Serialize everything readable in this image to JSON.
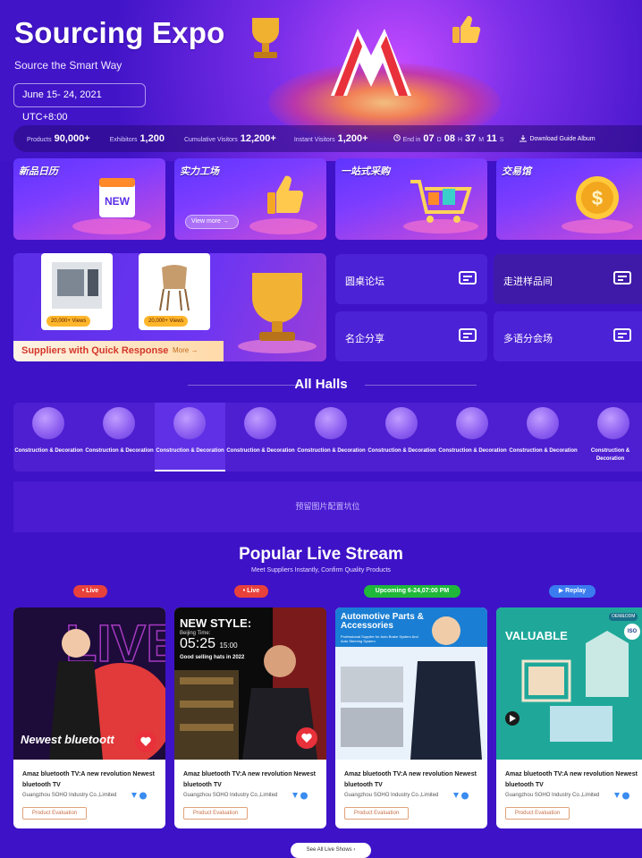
{
  "hero": {
    "title": "Sourcing Expo",
    "subtitle": "Source the Smart Way",
    "date": "June 15- 24, 2021 UTC+8:00"
  },
  "stats": {
    "products_label": "Products",
    "products_value": "90,000+",
    "exhibitors_label": "Exhibitors",
    "exhibitors_value": "1,200",
    "cumulative_label": "Cumulative Visitors",
    "cumulative_value": "12,200+",
    "instant_label": "Instant Visitors",
    "instant_value": "1,200+",
    "end_label": "End in",
    "days": "07",
    "days_unit": "D",
    "hours": "08",
    "hours_unit": "H",
    "minutes": "37",
    "minutes_unit": "M",
    "seconds": "11",
    "seconds_unit": "S",
    "download_label": "Download Guide Album"
  },
  "categories": [
    {
      "title": "新品日历"
    },
    {
      "title": "实力工场",
      "view_more": "View more"
    },
    {
      "title": "一站式采购"
    },
    {
      "title": "交易馆"
    }
  ],
  "suppliers": {
    "title": "Suppliers with Quick Response",
    "more": "More",
    "products": [
      {
        "views": "20,000+ Views"
      },
      {
        "views": "20,000+ Views"
      }
    ]
  },
  "forums": [
    {
      "label": "圆桌论坛"
    },
    {
      "label": "走进样品间"
    },
    {
      "label": "名企分享"
    },
    {
      "label": "多语分会场"
    }
  ],
  "halls": {
    "title": "All Halls",
    "items": [
      {
        "label": "Construction & Decoration"
      },
      {
        "label": "Construction & Decoration"
      },
      {
        "label": "Construction & Decoration"
      },
      {
        "label": "Construction & Decoration"
      },
      {
        "label": "Construction & Decoration"
      },
      {
        "label": "Construction & Decoration"
      },
      {
        "label": "Construction & Decoration"
      },
      {
        "label": "Construction & Decoration"
      },
      {
        "label": "Construction & Decoration"
      }
    ]
  },
  "reserve": {
    "text": "预留图片配置坑位"
  },
  "live": {
    "title": "Popular Live Stream",
    "subtitle": "Meet Suppliers Instantly, Confirm Quality Products",
    "cards": [
      {
        "badge": "Live",
        "image_text": "Newest bluetoott",
        "title": "Amaz bluetooth TV:A new revolution Newest bluetooth TV",
        "company": "Guangzhou SOHO Industry Co.,Limited",
        "button": "Product Evaluation"
      },
      {
        "badge": "Live",
        "image_title": "NEW STYLE:",
        "image_sub": "Beijing Time:",
        "image_time": "05:25",
        "image_time_small": "15:00",
        "image_caption": "Good selling hats in 2022",
        "title": "Amaz bluetooth TV:A new revolution Newest bluetooth TV",
        "company": "Guangzhou SOHO Industry Co.,Limited",
        "button": "Product Evaluation"
      },
      {
        "badge": "Upcoming 6-24,07:00 PM",
        "image_title": "Automotive Parts & Accessories",
        "image_sub": "Professional Supplier for Auto Brake System And Auto Steering System",
        "title": "Amaz bluetooth TV:A new revolution Newest bluetooth TV",
        "company": "Guangzhou SOHO Industry Co.,Limited",
        "button": "Product Evaluation"
      },
      {
        "badge": "Replay",
        "image_title": "VALUABLE",
        "image_tag": "OEM&ODM",
        "image_iso": "ISO",
        "title": "Amaz bluetooth TV:A new revolution Newest bluetooth TV",
        "company": "Guangzhou SOHO Industry Co.,Limited",
        "button": "Product Evaluation"
      }
    ],
    "see_all": "See All Live Shows"
  },
  "colors": {
    "background": "#3e12c7",
    "live_badge": "#e8413c",
    "upcoming_badge": "#1fb83a",
    "replay_badge": "#3a7cf0",
    "supplier_title": "#d4382a"
  }
}
